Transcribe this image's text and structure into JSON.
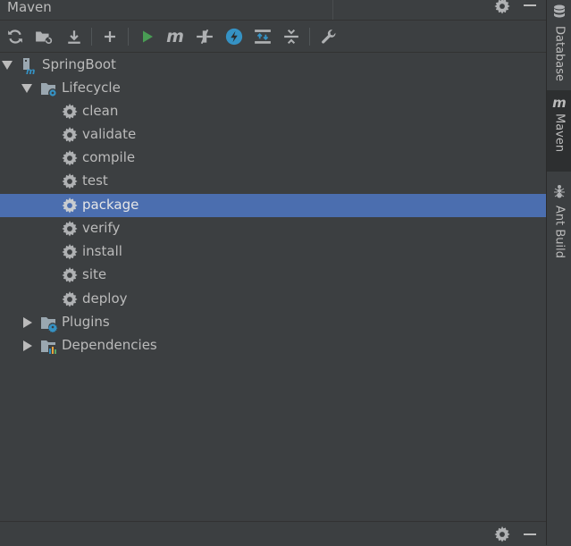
{
  "panel": {
    "title": "Maven"
  },
  "toolbar": {
    "buttons": [
      "reload-icon",
      "generate-sources-icon",
      "download-icon",
      "add-icon",
      "run-icon",
      "execute-goal-icon",
      "toggle-offline-icon",
      "skip-tests-icon",
      "show-dependencies-icon",
      "collapse-all-icon",
      "settings-wrench-icon"
    ]
  },
  "tree": {
    "project": "SpringBoot",
    "lifecycle": {
      "label": "Lifecycle",
      "goals": [
        "clean",
        "validate",
        "compile",
        "test",
        "package",
        "verify",
        "install",
        "site",
        "deploy"
      ],
      "selected": "package"
    },
    "plugins": "Plugins",
    "dependencies": "Dependencies"
  },
  "right_strip": {
    "tabs": [
      "Database",
      "Maven",
      "Ant Build"
    ],
    "active": "Maven"
  },
  "colors": {
    "background": "#3c3f41",
    "selection": "#4b6eaf",
    "text": "#bbbbbb",
    "run_green": "#499c54",
    "accent_blue": "#3592c4"
  }
}
